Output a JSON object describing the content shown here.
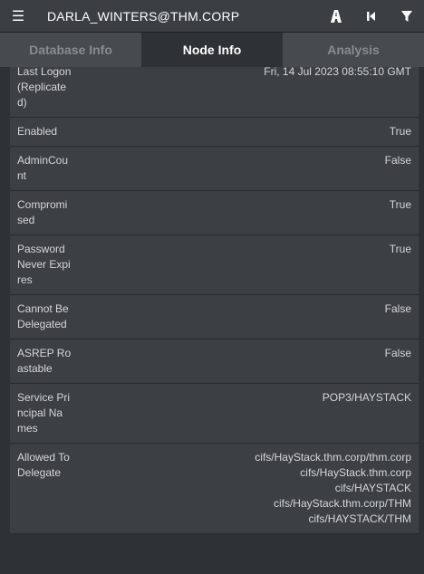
{
  "header": {
    "search_value": "DARLA_WINTERS@THM.CORP",
    "icons": [
      "menu-icon",
      "pathfinding-icon",
      "back-icon",
      "filter-icon"
    ]
  },
  "tabs": [
    {
      "label": "Database Info",
      "active": false
    },
    {
      "label": "Node Info",
      "active": true
    },
    {
      "label": "Analysis",
      "active": false
    }
  ],
  "properties": [
    {
      "label": "Last Logon (Replicated)",
      "value": [
        "Fri, 14 Jul 2023 08:55:10 GMT"
      ]
    },
    {
      "label": "Enabled",
      "value": [
        "True"
      ]
    },
    {
      "label": "AdminCount",
      "value": [
        "False"
      ]
    },
    {
      "label": "Compromised",
      "value": [
        "True"
      ]
    },
    {
      "label": "Password Never Expires",
      "value": [
        "True"
      ]
    },
    {
      "label": "Cannot Be Delegated",
      "value": [
        "False"
      ]
    },
    {
      "label": "ASREP Roastable",
      "value": [
        "False"
      ]
    },
    {
      "label": "Service Principal Names",
      "value": [
        "POP3/HAYSTACK"
      ]
    },
    {
      "label": "Allowed To Delegate",
      "value": [
        "cifs/HayStack.thm.corp/thm.corp",
        "cifs/HayStack.thm.corp",
        "cifs/HAYSTACK",
        "cifs/HayStack.thm.corp/THM",
        "cifs/HAYSTACK/THM"
      ]
    }
  ]
}
